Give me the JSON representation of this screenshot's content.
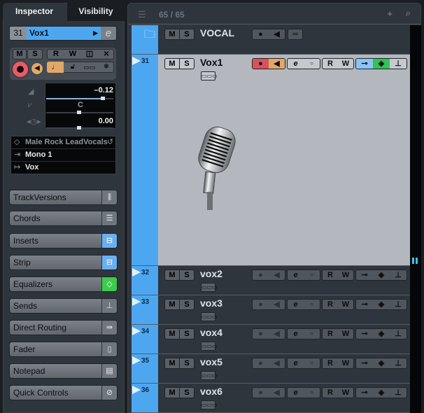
{
  "inspector": {
    "tabs": [
      {
        "label": "Inspector",
        "active": true
      },
      {
        "label": "Visibility",
        "active": false
      }
    ],
    "track": {
      "number": "31",
      "name": "Vox1",
      "edit_icon": "e"
    },
    "controls": {
      "mute": "M",
      "solo": "S",
      "read": "R",
      "write": "W",
      "record_active": true,
      "monitor_active": true
    },
    "values": {
      "volume": "–0.12",
      "pan": "C",
      "delay": "0.00",
      "volume_fraction": 0.85,
      "pan_fraction": 0.5,
      "delay_fraction": 0.5
    },
    "routing": {
      "preset": "Male Rock LeadVocals",
      "input": "Mono 1",
      "output": "Vox"
    },
    "sections": [
      {
        "label": "TrackVersions",
        "icon": "track-versions-icon",
        "state": "none"
      },
      {
        "label": "Chords",
        "icon": "chords-icon",
        "state": "none"
      },
      {
        "label": "Inserts",
        "icon": "inserts-icon",
        "state": "blue"
      },
      {
        "label": "Strip",
        "icon": "strip-icon",
        "state": "blue"
      },
      {
        "label": "Equalizers",
        "icon": "eq-icon",
        "state": "green"
      },
      {
        "label": "Sends",
        "icon": "sends-icon",
        "state": "none"
      },
      {
        "label": "Direct Routing",
        "icon": "direct-routing-icon",
        "state": "none"
      },
      {
        "label": "Fader",
        "icon": "fader-icon",
        "state": "none"
      },
      {
        "label": "Notepad",
        "icon": "notepad-icon",
        "state": "none"
      },
      {
        "label": "Quick Controls",
        "icon": "quick-controls-icon",
        "state": "none"
      }
    ]
  },
  "project": {
    "counter": "65 / 65",
    "folder": {
      "name": "VOCAL",
      "mute": "M",
      "solo": "S"
    },
    "tracks": [
      {
        "number": "31",
        "name": "Vox1",
        "selected": true
      },
      {
        "number": "32",
        "name": "vox2",
        "selected": false
      },
      {
        "number": "33",
        "name": "vox3",
        "selected": false
      },
      {
        "number": "34",
        "name": "vox4",
        "selected": false
      },
      {
        "number": "35",
        "name": "vox5",
        "selected": false
      },
      {
        "number": "36",
        "name": "vox6",
        "selected": false
      }
    ],
    "button_labels": {
      "mute": "M",
      "solo": "S",
      "read": "R",
      "write": "W",
      "edit": "e"
    }
  },
  "colors": {
    "selection_blue": "#4da7f0",
    "record_red": "#ec5a64",
    "monitor_orange": "#e0a868",
    "eq_green": "#3ccc4a"
  }
}
